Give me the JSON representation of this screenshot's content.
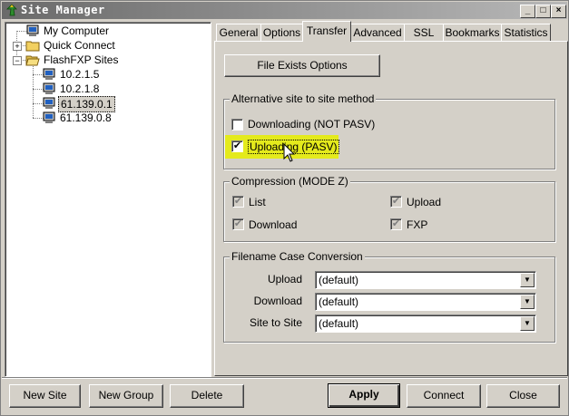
{
  "window": {
    "title": "Site Manager"
  },
  "titlebar_buttons": [
    "_",
    "□",
    "×"
  ],
  "tree": {
    "items": [
      {
        "label": "My Computer",
        "icon": "computer-icon"
      },
      {
        "label": "Quick Connect",
        "icon": "folder-icon"
      },
      {
        "label": "FlashFXP Sites",
        "icon": "folder-open-icon"
      },
      {
        "label": "10.2.1.5",
        "icon": "computer-icon"
      },
      {
        "label": "10.2.1.8",
        "icon": "computer-icon"
      },
      {
        "label": "61.139.0.1",
        "icon": "computer-icon",
        "selected": true
      },
      {
        "label": "61.139.0.8",
        "icon": "computer-icon"
      }
    ]
  },
  "tabs": [
    "General",
    "Options",
    "Transfer",
    "Advanced",
    "SSL",
    "Bookmarks",
    "Statistics"
  ],
  "active_tab": "Transfer",
  "transfer": {
    "file_exists_button": "File Exists Options",
    "alt_site_group": "Alternative site to site method",
    "downloading_label": "Downloading (NOT PASV)",
    "uploading_label": "Uploading (PASV)",
    "downloading_checked": false,
    "uploading_checked": true,
    "compression_group": "Compression (MODE Z)",
    "comp_list": "List",
    "comp_upload": "Upload",
    "comp_download": "Download",
    "comp_fxp": "FXP",
    "filename_group": "Filename Case Conversion",
    "upload_label": "Upload",
    "download_label": "Download",
    "site_to_site_label": "Site to Site",
    "upload_value": "(default)",
    "download_value": "(default)",
    "site_to_site_value": "(default)"
  },
  "buttons": {
    "new_site": "New Site",
    "new_group": "New Group",
    "delete": "Delete",
    "apply": "Apply",
    "connect": "Connect",
    "close": "Close"
  },
  "colors": {
    "highlight": "#e4ea1c",
    "face": "#d4d0c8"
  }
}
